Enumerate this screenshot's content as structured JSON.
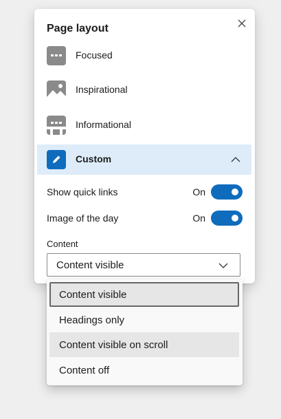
{
  "panel": {
    "title": "Page layout",
    "close_icon": "close-icon",
    "layouts": [
      {
        "label": "Focused",
        "icon": "focused-layout-icon"
      },
      {
        "label": "Inspirational",
        "icon": "inspirational-layout-icon"
      },
      {
        "label": "Informational",
        "icon": "informational-layout-icon"
      },
      {
        "label": "Custom",
        "icon": "custom-edit-icon",
        "selected": true,
        "expanded": true
      }
    ],
    "toggles": [
      {
        "label": "Show quick links",
        "state": "On",
        "on": true
      },
      {
        "label": "Image of the day",
        "state": "On",
        "on": true
      }
    ],
    "content": {
      "label": "Content",
      "selected": "Content visible"
    }
  },
  "dropdown": {
    "options": [
      {
        "label": "Content visible",
        "focused": true
      },
      {
        "label": "Headings only"
      },
      {
        "label": "Content visible on scroll",
        "hovered": true
      },
      {
        "label": "Content off"
      }
    ]
  },
  "colors": {
    "accent": "#0f6cbd",
    "selected_row": "#deecf9",
    "icon_gray": "#8a8a8a"
  }
}
